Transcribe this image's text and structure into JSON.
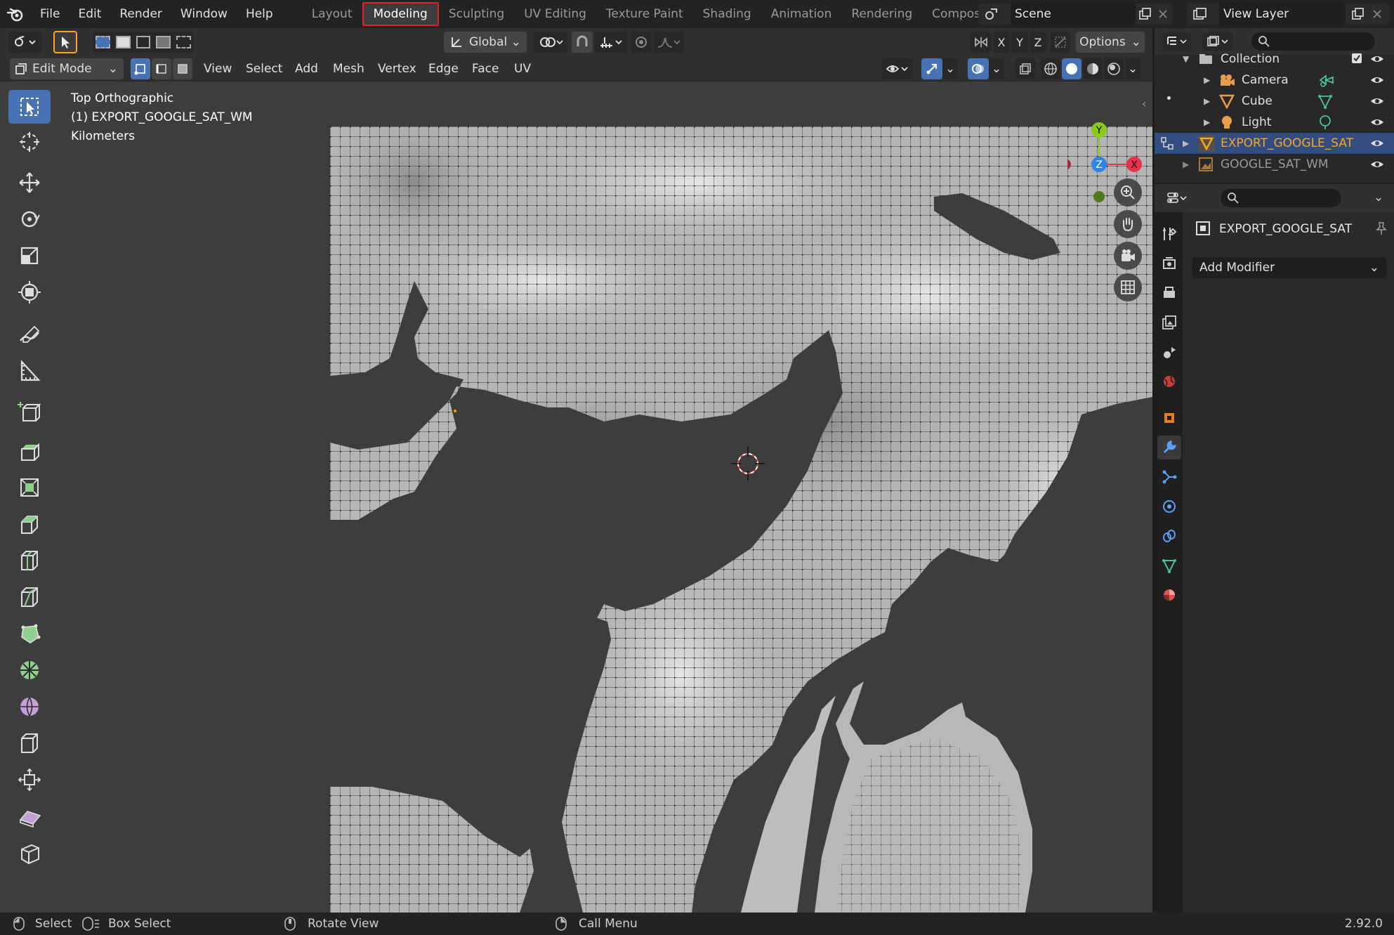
{
  "menus": [
    "File",
    "Edit",
    "Render",
    "Window",
    "Help"
  ],
  "workspaces": [
    {
      "label": "Layout",
      "active": false
    },
    {
      "label": "Modeling",
      "active": true
    },
    {
      "label": "Sculpting",
      "active": false
    },
    {
      "label": "UV Editing",
      "active": false
    },
    {
      "label": "Texture Paint",
      "active": false
    },
    {
      "label": "Shading",
      "active": false
    },
    {
      "label": "Animation",
      "active": false
    },
    {
      "label": "Rendering",
      "active": false
    },
    {
      "label": "Compositing",
      "active": false
    }
  ],
  "scene": {
    "name": "Scene"
  },
  "view_layer": {
    "name": "View Layer"
  },
  "viewport": {
    "transform_orientation": "Global",
    "options_label": "Options",
    "axes": [
      "X",
      "Y",
      "Z"
    ],
    "mode": "Edit Mode",
    "header_menus": [
      "View",
      "Select",
      "Add",
      "Mesh",
      "Vertex",
      "Edge",
      "Face",
      "UV"
    ],
    "overlay": {
      "view_name": "Top Orthographic",
      "object_name": "(1) EXPORT_GOOGLE_SAT_WM",
      "units": "Kilometers"
    },
    "gizmo": {
      "y": "Y",
      "z": "Z",
      "x": "X"
    }
  },
  "outliner": {
    "collection": "Collection",
    "items": [
      {
        "name": "Camera",
        "type": "camera"
      },
      {
        "name": "Cube",
        "type": "mesh"
      },
      {
        "name": "Light",
        "type": "light"
      }
    ],
    "selected": "EXPORT_GOOGLE_SAT",
    "extra": "GOOGLE_SAT_WM"
  },
  "properties": {
    "object_name": "EXPORT_GOOGLE_SAT",
    "add_modifier": "Add Modifier"
  },
  "statusbar": {
    "select": "Select",
    "box_select": "Box Select",
    "rotate_view": "Rotate View",
    "call_menu": "Call Menu",
    "version": "2.92.0"
  },
  "colors": {
    "accent": "#4772b3",
    "highlight_red": "#e0222a",
    "selected_orange": "#f5a623",
    "axis_x": "#e8334a",
    "axis_y": "#8bc91a",
    "axis_z": "#2f83e4"
  }
}
